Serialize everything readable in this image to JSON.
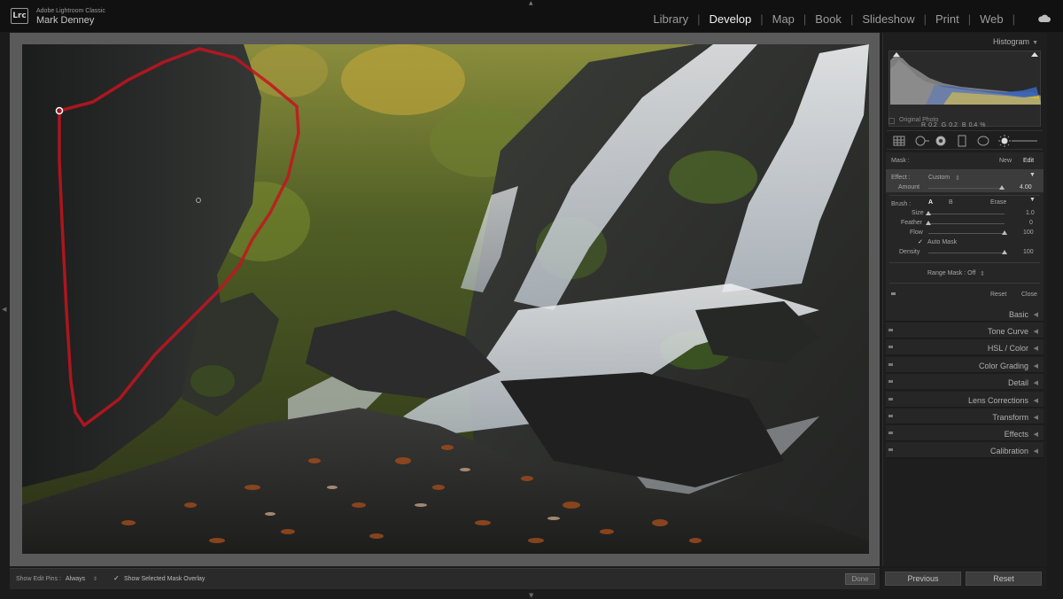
{
  "app": {
    "logo": "Lrc",
    "name": "Adobe Lightroom Classic",
    "user": "Mark Denney"
  },
  "modules": [
    "Library",
    "Develop",
    "Map",
    "Book",
    "Slideshow",
    "Print",
    "Web"
  ],
  "active_module": "Develop",
  "histogram": {
    "title": "Histogram",
    "r_label": "R",
    "r_value": "0.2",
    "g_label": "G",
    "g_value": "0.2",
    "b_label": "B",
    "b_value": "0.4",
    "unit": "%",
    "original_photo_label": "Original Photo"
  },
  "mask": {
    "label": "Mask :",
    "new_label": "New",
    "edit_label": "Edit",
    "effect_label": "Effect :",
    "effect_value": "Custom",
    "amount_label": "Amount",
    "amount_value": "4.00",
    "amount_fraction": 0.97,
    "brush_label": "Brush :",
    "brush_a": "A",
    "brush_b": "B",
    "brush_erase": "Erase",
    "size_label": "Size",
    "size_value": "1.0",
    "size_fraction": 0.0,
    "feather_label": "Feather",
    "feather_value": "0",
    "feather_fraction": 0.0,
    "flow_label": "Flow",
    "flow_value": "100",
    "flow_fraction": 1.0,
    "auto_mask_label": "Auto Mask",
    "density_label": "Density",
    "density_value": "100",
    "density_fraction": 1.0,
    "range_mask_label": "Range Mask : Off",
    "reset_label": "Reset",
    "close_label": "Close"
  },
  "sections": [
    "Basic",
    "Tone Curve",
    "HSL / Color",
    "Color Grading",
    "Detail",
    "Lens Corrections",
    "Transform",
    "Effects",
    "Calibration"
  ],
  "toolbar": {
    "show_edit_pins_label": "Show Edit Pins :",
    "show_edit_pins_value": "Always",
    "show_mask_overlay_label": "Show Selected Mask Overlay",
    "done_label": "Done"
  },
  "buttons": {
    "previous": "Previous",
    "reset": "Reset"
  },
  "colors": {
    "mask_overlay": "#c4141e",
    "active_module": "#f2f2f2"
  }
}
